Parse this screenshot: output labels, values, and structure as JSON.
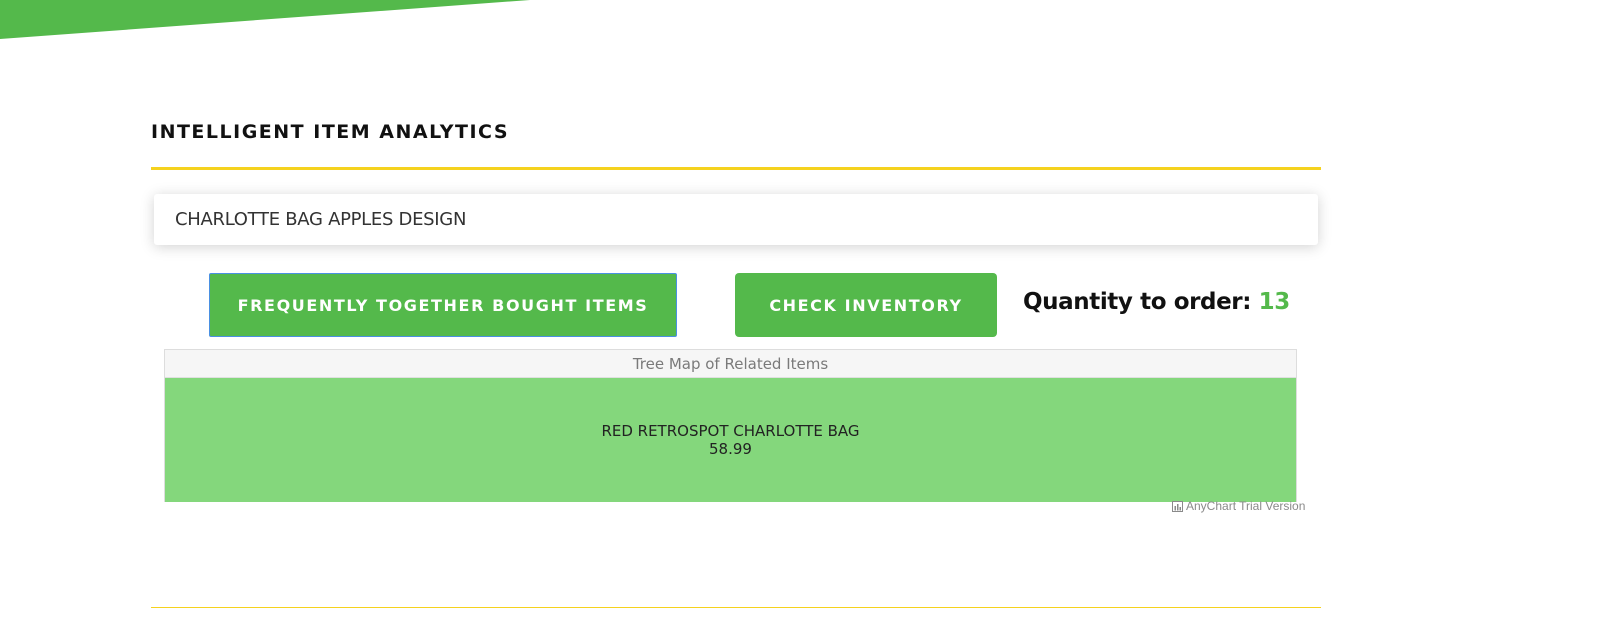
{
  "colors": {
    "brand_green": "#54b94b",
    "accent_yellow": "#f5d21e",
    "tile_green": "#84d77c"
  },
  "header": {
    "title": "INTELLIGENT ITEM ANALYTICS"
  },
  "search": {
    "value": "CHARLOTTE BAG APPLES DESIGN"
  },
  "actions": {
    "related_label": "FREQUENTLY TOGETHER BOUGHT ITEMS",
    "inventory_label": "CHECK INVENTORY"
  },
  "quantity": {
    "label": "Quantity to order:",
    "value": "13"
  },
  "treemap": {
    "title": "Tree Map of Related Items",
    "credits": "AnyChart Trial Version",
    "credits_icon": "bar-chart-icon"
  },
  "chart_data": {
    "type": "treemap",
    "title": "Tree Map of Related Items",
    "items": [
      {
        "name": "RED RETROSPOT CHARLOTTE BAG",
        "value": 58.99
      }
    ]
  }
}
